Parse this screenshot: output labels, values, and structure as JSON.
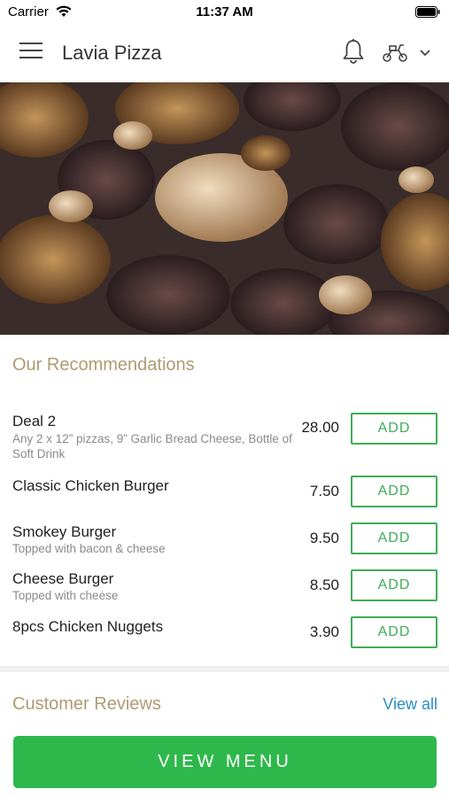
{
  "status_bar": {
    "carrier": "Carrier",
    "time": "11:37 AM"
  },
  "header": {
    "title": "Lavia Pizza",
    "icons": [
      "menu-icon",
      "bell-icon",
      "scooter-icon",
      "chevron-down-icon"
    ]
  },
  "recommendations": {
    "title": "Our Recommendations",
    "items": [
      {
        "name": "Deal 2",
        "description": "Any 2 x 12” pizzas, 9” Garlic Bread Cheese, Bottle of Soft Drink",
        "price": "28.00",
        "add_label": "ADD"
      },
      {
        "name": "Classic Chicken Burger",
        "description": "",
        "price": "7.50",
        "add_label": "ADD"
      },
      {
        "name": "Smokey Burger",
        "description": "Topped with bacon & cheese",
        "price": "9.50",
        "add_label": "ADD"
      },
      {
        "name": "Cheese Burger",
        "description": "Topped with cheese",
        "price": "8.50",
        "add_label": "ADD"
      },
      {
        "name": "8pcs Chicken Nuggets",
        "description": "",
        "price": "3.90",
        "add_label": "ADD"
      }
    ]
  },
  "reviews": {
    "title": "Customer Reviews",
    "view_all_label": "View all"
  },
  "footer": {
    "view_menu_label": "VIEW MENU"
  },
  "colors": {
    "accent_green": "#2eb84b",
    "section_gold": "#ad9b72",
    "link_blue": "#2a8ec4"
  }
}
